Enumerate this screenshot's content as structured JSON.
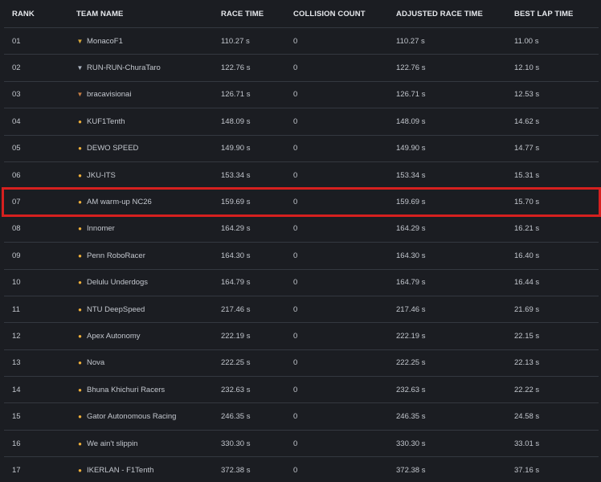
{
  "headers": {
    "rank": "RANK",
    "team": "TEAM NAME",
    "race": "RACE TIME",
    "collision": "COLLISION COUNT",
    "adjusted": "ADJUSTED RACE TIME",
    "best": "BEST LAP TIME"
  },
  "rows": [
    {
      "rank": "01",
      "team": "MonacoF1",
      "race": "110.27 s",
      "collision": "0",
      "adjusted": "110.27 s",
      "best": "11.00 s",
      "medal": "gold-medal-icon",
      "medal_color": "#d9a93a"
    },
    {
      "rank": "02",
      "team": "RUN-RUN-ChuraTaro",
      "race": "122.76 s",
      "collision": "0",
      "adjusted": "122.76 s",
      "best": "12.10 s",
      "medal": "silver-medal-icon",
      "medal_color": "#aeb6c2"
    },
    {
      "rank": "03",
      "team": "bracavisionai",
      "race": "126.71 s",
      "collision": "0",
      "adjusted": "126.71 s",
      "best": "12.53 s",
      "medal": "bronze-medal-icon",
      "medal_color": "#c77f45"
    },
    {
      "rank": "04",
      "team": "KUF1Tenth",
      "race": "148.09 s",
      "collision": "0",
      "adjusted": "148.09 s",
      "best": "14.62 s",
      "medal": "participant-badge-icon",
      "medal_color": "#f0b03a"
    },
    {
      "rank": "05",
      "team": "DEWO SPEED",
      "race": "149.90 s",
      "collision": "0",
      "adjusted": "149.90 s",
      "best": "14.77 s",
      "medal": "participant-badge-icon",
      "medal_color": "#f0b03a"
    },
    {
      "rank": "06",
      "team": "JKU-ITS",
      "race": "153.34 s",
      "collision": "0",
      "adjusted": "153.34 s",
      "best": "15.31 s",
      "medal": "participant-badge-icon",
      "medal_color": "#f0b03a"
    },
    {
      "rank": "07",
      "team": "AM warm-up NC26",
      "race": "159.69 s",
      "collision": "0",
      "adjusted": "159.69 s",
      "best": "15.70 s",
      "medal": "participant-badge-icon",
      "medal_color": "#f0b03a"
    },
    {
      "rank": "08",
      "team": "Innomer",
      "race": "164.29 s",
      "collision": "0",
      "adjusted": "164.29 s",
      "best": "16.21 s",
      "medal": "participant-badge-icon",
      "medal_color": "#f0b03a"
    },
    {
      "rank": "09",
      "team": "Penn RoboRacer",
      "race": "164.30 s",
      "collision": "0",
      "adjusted": "164.30 s",
      "best": "16.40 s",
      "medal": "participant-badge-icon",
      "medal_color": "#f0b03a"
    },
    {
      "rank": "10",
      "team": "Delulu Underdogs",
      "race": "164.79 s",
      "collision": "0",
      "adjusted": "164.79 s",
      "best": "16.44 s",
      "medal": "participant-badge-icon",
      "medal_color": "#f0b03a"
    },
    {
      "rank": "11",
      "team": "NTU DeepSpeed",
      "race": "217.46 s",
      "collision": "0",
      "adjusted": "217.46 s",
      "best": "21.69 s",
      "medal": "participant-badge-icon",
      "medal_color": "#f0b03a"
    },
    {
      "rank": "12",
      "team": "Apex Autonomy",
      "race": "222.19 s",
      "collision": "0",
      "adjusted": "222.19 s",
      "best": "22.15 s",
      "medal": "participant-badge-icon",
      "medal_color": "#f0b03a"
    },
    {
      "rank": "13",
      "team": "Nova",
      "race": "222.25 s",
      "collision": "0",
      "adjusted": "222.25 s",
      "best": "22.13 s",
      "medal": "participant-badge-icon",
      "medal_color": "#f0b03a"
    },
    {
      "rank": "14",
      "team": "Bhuna Khichuri Racers",
      "race": "232.63 s",
      "collision": "0",
      "adjusted": "232.63 s",
      "best": "22.22 s",
      "medal": "participant-badge-icon",
      "medal_color": "#f0b03a"
    },
    {
      "rank": "15",
      "team": "Gator Autonomous Racing",
      "race": "246.35 s",
      "collision": "0",
      "adjusted": "246.35 s",
      "best": "24.58 s",
      "medal": "participant-badge-icon",
      "medal_color": "#f0b03a"
    },
    {
      "rank": "16",
      "team": "We ain't slippin",
      "race": "330.30 s",
      "collision": "0",
      "adjusted": "330.30 s",
      "best": "33.01 s",
      "medal": "participant-badge-icon",
      "medal_color": "#f0b03a"
    },
    {
      "rank": "17",
      "team": "IKERLAN - F1Tenth",
      "race": "372.38 s",
      "collision": "0",
      "adjusted": "372.38 s",
      "best": "37.16 s",
      "medal": "participant-badge-icon",
      "medal_color": "#f0b03a"
    }
  ],
  "highlight": {
    "rank": "07",
    "color": "#d6201f"
  }
}
